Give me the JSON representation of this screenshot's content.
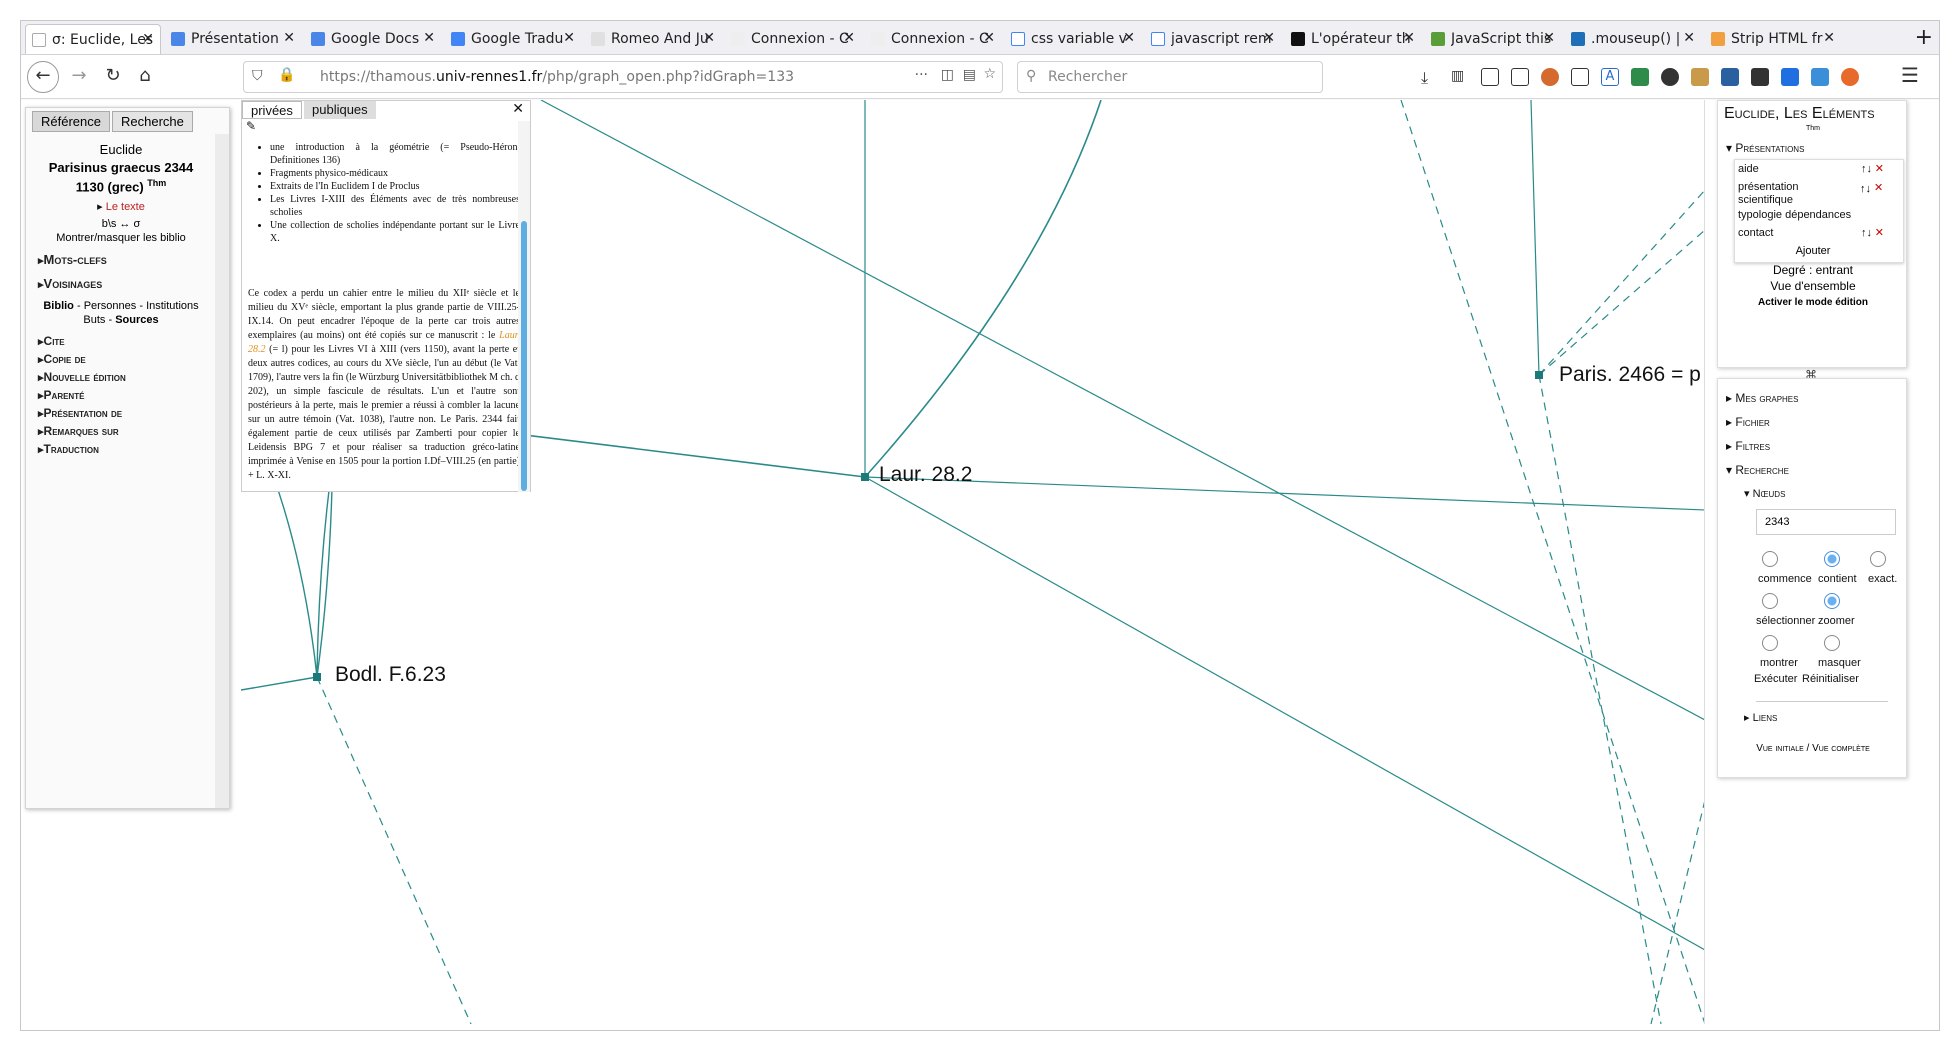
{
  "browser": {
    "tabs": [
      {
        "label": "σ: Euclide, Les Él",
        "active": true
      },
      {
        "label": "Présentation"
      },
      {
        "label": "Google Docs"
      },
      {
        "label": "Google Tradu"
      },
      {
        "label": "Romeo And Ju"
      },
      {
        "label": "Connexion - C"
      },
      {
        "label": "Connexion - C"
      },
      {
        "label": "css variable v"
      },
      {
        "label": "javascript rem"
      },
      {
        "label": "L'opérateur th"
      },
      {
        "label": "JavaScript this"
      },
      {
        "label": ".mouseup() |"
      },
      {
        "label": "Strip HTML fr"
      }
    ],
    "url_scheme": "https://thamous.",
    "url_domain": "univ-rennes1.fr",
    "url_path": "/php/graph_open.php?idGraph=133",
    "search_placeholder": "Rechercher",
    "icons": [
      "back-icon",
      "forward-icon",
      "reload-icon",
      "home-icon",
      "download-icon",
      "library-icon",
      "sidebar-icon",
      "menu-icon"
    ]
  },
  "left": {
    "tabs": [
      "Référence",
      "Recherche"
    ],
    "author": "Euclide",
    "manuscript": "Parisinus graecus 2344",
    "date": "1130 (grec)",
    "date_sup": "Thm",
    "texte_link": "Le texte",
    "symbols": "b\\s ↔ σ",
    "toggle_biblio": "Montrer/masquer les biblio",
    "sections1": [
      "Mots-clefs",
      "Voisinages"
    ],
    "biblio_line1": [
      "Biblio",
      "Personnes",
      "Institutions"
    ],
    "biblio_line2": [
      "Buts",
      "Sources"
    ],
    "sections2": [
      "Cite",
      "Copie de",
      "Nouvelle édition",
      "Parenté",
      "Présentation de",
      "Remarques sur",
      "Traduction"
    ]
  },
  "note": {
    "tabs": [
      "privées",
      "publiques"
    ],
    "close": "✕",
    "edit_icon": "pencil-icon",
    "items": [
      "une introduction à la géométrie (= Pseudo-Héron, Definitiones 136)",
      "Fragments physico-médicaux",
      "Extraits de l'In Euclidem I de Proclus",
      "Les Livres I-XIII des Éléments avec de très nombreuses scholies",
      "Une collection de scholies indépendante portant sur le Livre X."
    ],
    "para_before": "Ce codex a perdu un cahier entre le milieu du XIIᵉ siècle et le milieu du XVᵉ siècle, emportant la plus grande partie de VIII.25-IX.14. On peut encadrer l'époque de la perte car trois autres exemplaires (au moins) ont été copiés sur ce manuscrit : le ",
    "link": "Laur. 28.2",
    "para_after": " (= l) pour les Livres VI à XIII (vers 1150), avant la perte et deux autres codices, au cours du XVe siècle, l'un au début (le Vat. 1709), l'autre vers la fin (le Würzburg Universitätbibliothek M ch. q 202), un simple fascicule de résultats. L'un et l'autre sont postérieurs à la perte, mais le premier a réussi à combler la lacune sur un autre témoin (Vat. 1038), l'autre non. Le Paris. 2344 fait également partie de ceux utilisés par Zamberti pour copier le Leidensis BPG 7 et pour réaliser sa traduction gréco-latine imprimée à Venise en 1505 pour la portion I.Df–VIII.25 (en partie) + L. X-XI."
  },
  "graph": {
    "nodes": [
      {
        "label": "Laur. 28.2"
      },
      {
        "label": "Paris. 2466 = p"
      },
      {
        "label": "Bodl. F.6.23"
      }
    ],
    "edge_color": "#2a8a8a",
    "node_color": "#1a7a7a"
  },
  "right": {
    "title": "Euclide, Les Eléments",
    "title_sup": "Thm",
    "presentations_label": "Présentations",
    "presentations": [
      "aide",
      "présentation scientifique",
      "typologie dépendances",
      "contact"
    ],
    "arrows": "↑↓",
    "remove": "✕",
    "add": "Ajouter",
    "degree": "Degré : entrant",
    "overview": "Vue d'ensemble",
    "edit_mode": "Activer le mode édition",
    "sections": [
      "Mes graphes",
      "Fichier",
      "Filtres"
    ],
    "search_label": "Recherche",
    "nodes_label": "Nœuds",
    "search_value": "2343",
    "radio1": [
      "commence",
      "contient",
      "exact."
    ],
    "radio2": [
      "sélectionner",
      "zoomer"
    ],
    "radio3": [
      "montrer",
      "masquer"
    ],
    "exec": "Exécuter",
    "reset": "Réinitialiser",
    "links_label": "Liens",
    "view_initial": "Vue initiale /",
    "view_full": "Vue complète"
  }
}
